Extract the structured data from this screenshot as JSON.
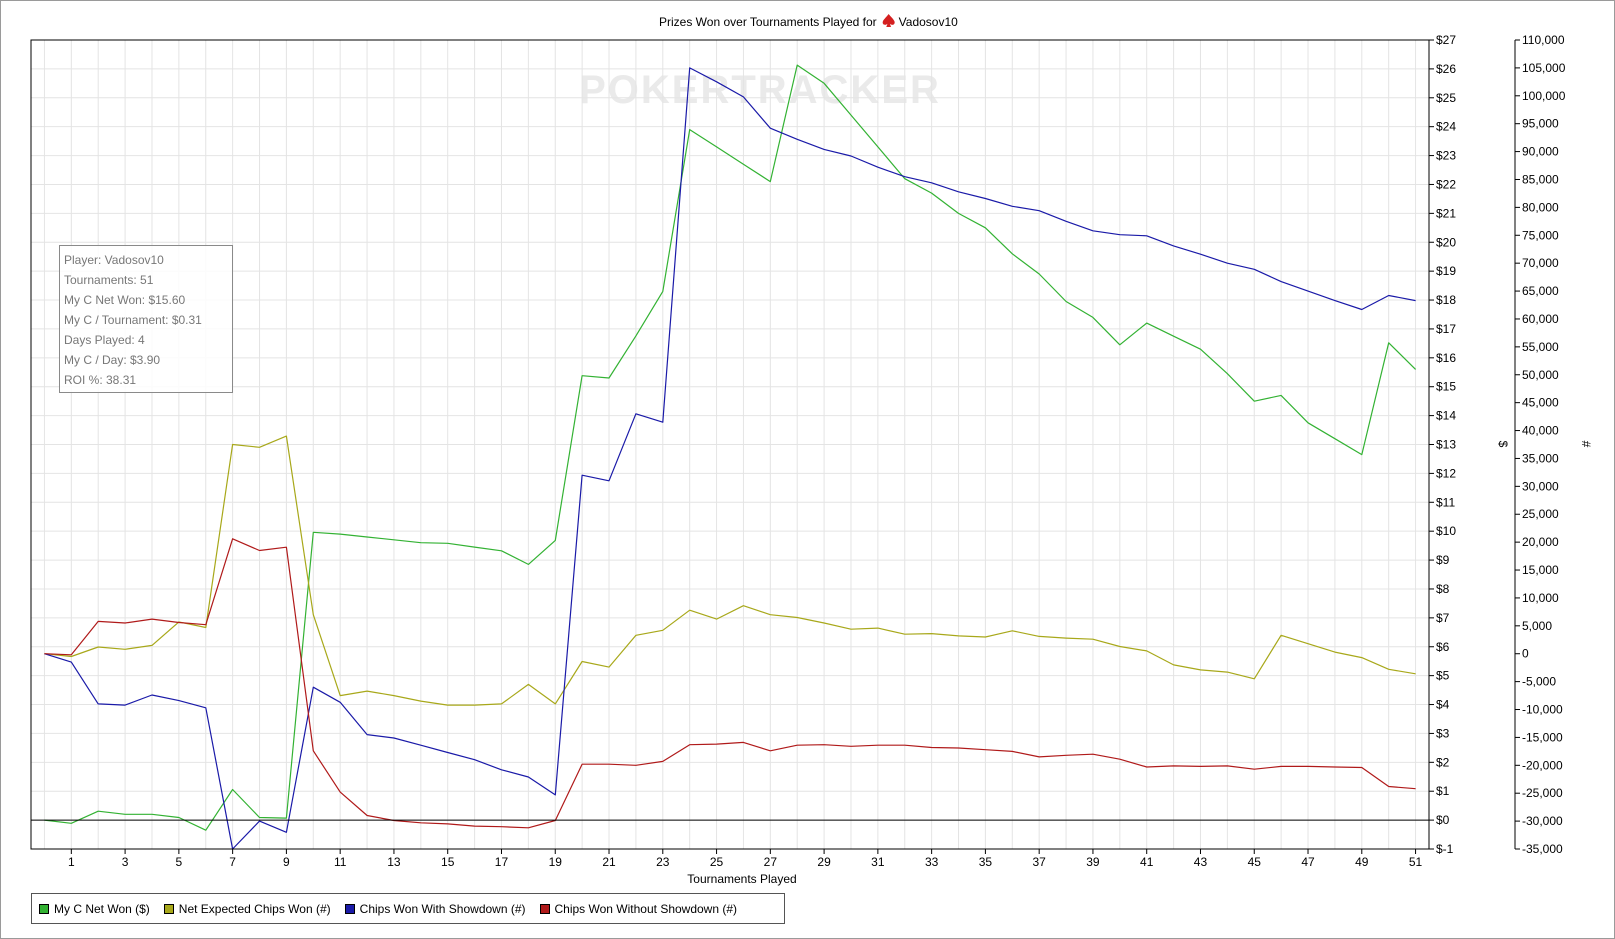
{
  "chart_data": {
    "type": "line",
    "title": "Prizes Won over Tournaments Played for",
    "player_name": "Vadosov10",
    "watermark": "POKERTRACKER",
    "xlabel": "Tournaments Played",
    "ylabel_left": "$",
    "ylabel_right": "#",
    "xlim": [
      -0.5,
      51.5
    ],
    "x_ticks": [
      1,
      3,
      5,
      7,
      9,
      11,
      13,
      15,
      17,
      19,
      21,
      23,
      25,
      27,
      29,
      31,
      33,
      35,
      37,
      39,
      41,
      43,
      45,
      47,
      49,
      51
    ],
    "ylim_dollars": [
      -1,
      27
    ],
    "y_ticks_dollars": [
      "$-1",
      "$0",
      "$1",
      "$2",
      "$3",
      "$4",
      "$5",
      "$6",
      "$7",
      "$8",
      "$9",
      "$10",
      "$11",
      "$12",
      "$13",
      "$14",
      "$15",
      "$16",
      "$17",
      "$18",
      "$19",
      "$20",
      "$21",
      "$22",
      "$23",
      "$24",
      "$25",
      "$26",
      "$27"
    ],
    "ylim_chips": [
      -35000,
      110000
    ],
    "y_ticks_chips": [
      "-35,000",
      "-30,000",
      "-25,000",
      "-20,000",
      "-15,000",
      "-10,000",
      "-5,000",
      "0",
      "5,000",
      "10,000",
      "15,000",
      "20,000",
      "25,000",
      "30,000",
      "35,000",
      "40,000",
      "45,000",
      "50,000",
      "55,000",
      "60,000",
      "65,000",
      "70,000",
      "75,000",
      "80,000",
      "85,000",
      "90,000",
      "95,000",
      "100,000",
      "105,000",
      "110,000"
    ],
    "grid": true,
    "legend_position": "bottom-left",
    "x": [
      0,
      1,
      2,
      3,
      4,
      5,
      6,
      7,
      8,
      9,
      10,
      11,
      12,
      13,
      14,
      15,
      16,
      17,
      18,
      19,
      20,
      21,
      22,
      23,
      24,
      25,
      26,
      27,
      28,
      29,
      30,
      31,
      32,
      33,
      34,
      35,
      36,
      37,
      38,
      39,
      40,
      41,
      42,
      43,
      44,
      45,
      46,
      47,
      48,
      49,
      50,
      51
    ],
    "series": [
      {
        "name": "My C Net Won ($)",
        "color": "#33b233",
        "axis": "dollars",
        "values": [
          0,
          -0.11,
          0.31,
          0.2,
          0.2,
          0.09,
          -0.35,
          1.06,
          0.09,
          0.07,
          9.96,
          9.9,
          9.8,
          9.7,
          9.6,
          9.58,
          9.45,
          9.32,
          8.85,
          9.68,
          15.38,
          15.3,
          16.76,
          18.3,
          23.9,
          23.3,
          22.7,
          22.1,
          26.13,
          25.5,
          24.4,
          23.3,
          22.2,
          21.7,
          21.0,
          20.5,
          19.6,
          18.9,
          17.95,
          17.4,
          16.45,
          17.2,
          16.75,
          16.3,
          15.45,
          14.5,
          14.7,
          13.75,
          13.2,
          12.65,
          16.52,
          15.6
        ]
      },
      {
        "name": "Net Expected Chips Won (#)",
        "color": "#a8a81a",
        "axis": "chips",
        "values": [
          0,
          -500,
          1200,
          800,
          1500,
          5700,
          4700,
          37500,
          37000,
          39000,
          7000,
          -7500,
          -6700,
          -7500,
          -8500,
          -9200,
          -9200,
          -9000,
          -5500,
          -9000,
          -1400,
          -2400,
          3300,
          4200,
          7800,
          6200,
          8600,
          7000,
          6500,
          5500,
          4400,
          4600,
          3500,
          3600,
          3200,
          3000,
          4100,
          3100,
          2800,
          2600,
          1300,
          500,
          -2000,
          -2900,
          -3300,
          -4500,
          3300,
          1800,
          300,
          -700,
          -2800,
          -3600
        ]
      },
      {
        "name": "Chips Won With Showdown (#)",
        "color": "#1a1aa8",
        "axis": "chips",
        "values": [
          0,
          -1500,
          -9000,
          -9200,
          -7400,
          -8400,
          -9700,
          -35000,
          -30000,
          -32000,
          -6000,
          -8700,
          -14500,
          -15100,
          -16400,
          -17700,
          -19000,
          -20800,
          -22100,
          -25300,
          32000,
          31000,
          43000,
          41500,
          105000,
          102500,
          99800,
          94200,
          92200,
          90400,
          89200,
          87200,
          85500,
          84400,
          82800,
          81600,
          80200,
          79400,
          77500,
          75800,
          75100,
          74900,
          73100,
          71600,
          70000,
          68900,
          66700,
          65000,
          63300,
          61700,
          64200,
          63300
        ]
      },
      {
        "name": "Chips Won Without Showdown (#)",
        "color": "#b01a1a",
        "axis": "chips",
        "values": [
          0,
          -200,
          5800,
          5500,
          6200,
          5600,
          5200,
          20600,
          18500,
          19100,
          -17400,
          -24800,
          -29000,
          -29900,
          -30300,
          -30500,
          -30900,
          -31000,
          -31200,
          -29900,
          -19800,
          -19800,
          -20000,
          -19300,
          -16300,
          -16200,
          -15900,
          -17400,
          -16400,
          -16300,
          -16600,
          -16400,
          -16400,
          -16800,
          -16900,
          -17200,
          -17500,
          -18500,
          -18200,
          -18000,
          -18900,
          -20300,
          -20100,
          -20200,
          -20100,
          -20700,
          -20200,
          -20200,
          -20300,
          -20400,
          -23800,
          -24200
        ]
      }
    ]
  },
  "info_box": {
    "line1": "Player: Vadosov10",
    "line2": "Tournaments: 51",
    "line3": "My C Net Won: $15.60",
    "line4": "My C / Tournament: $0.31",
    "line5": "Days Played: 4",
    "line6": "My C / Day: $3.90",
    "line7": "ROI %: 38.31"
  },
  "legend": {
    "item1": "My C Net Won ($)",
    "item2": "Net Expected Chips Won (#)",
    "item3": "Chips Won With Showdown (#)",
    "item4": "Chips Won Without Showdown (#)"
  }
}
